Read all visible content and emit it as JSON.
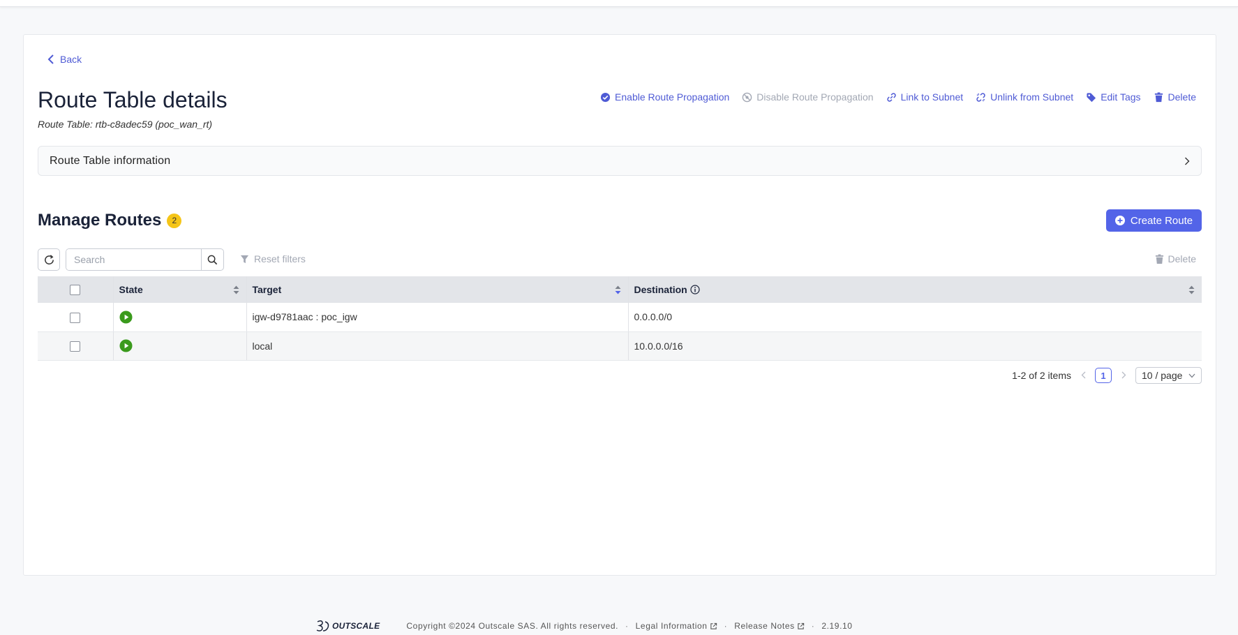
{
  "back_label": "Back",
  "page": {
    "title": "Route Table details",
    "subtitle": "Route Table: rtb-c8adec59 (poc_wan_rt)"
  },
  "actions": {
    "enable_propagation": "Enable Route Propagation",
    "disable_propagation": "Disable Route Propagation",
    "link_subnet": "Link to Subnet",
    "unlink_subnet": "Unlink from Subnet",
    "edit_tags": "Edit Tags",
    "delete": "Delete"
  },
  "info_panel": {
    "label": "Route Table information"
  },
  "manage_routes": {
    "title": "Manage Routes",
    "count": "2",
    "create_label": "Create Route"
  },
  "toolbar": {
    "search_placeholder": "Search",
    "reset_filters": "Reset filters",
    "delete": "Delete"
  },
  "table": {
    "columns": {
      "state": "State",
      "target": "Target",
      "destination": "Destination"
    },
    "rows": [
      {
        "state": "active",
        "target": "igw-d9781aac : poc_igw",
        "destination": "0.0.0.0/0"
      },
      {
        "state": "active",
        "target": "local",
        "destination": "10.0.0.0/16"
      }
    ]
  },
  "pagination": {
    "summary": "1-2 of 2 items",
    "current_page": "1",
    "page_size": "10 / page"
  },
  "footer": {
    "brand": "OUTSCALE",
    "copyright": "Copyright ©2024 Outscale SAS. All rights reserved.",
    "legal": "Legal Information",
    "release_notes": "Release Notes",
    "version": "2.19.10"
  },
  "colors": {
    "primary": "#5364e8",
    "link": "#4f5bd5",
    "badge": "#f5c518",
    "state_active": "#3a9a1c"
  }
}
